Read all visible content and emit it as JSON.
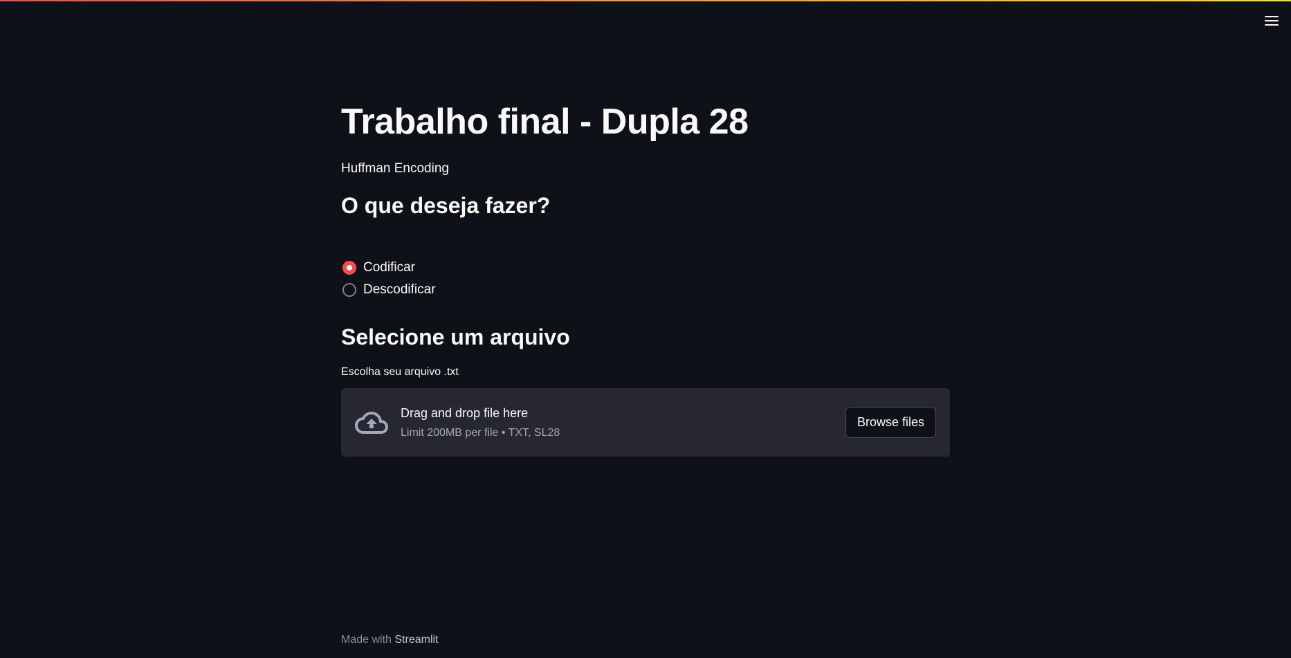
{
  "header": {
    "menu_icon": "hamburger-menu-icon"
  },
  "main": {
    "title": "Trabalho final - Dupla 28",
    "subtitle": "Huffman Encoding",
    "question": "O que deseja fazer?",
    "radio": {
      "options": [
        "Codificar",
        "Descodificar"
      ],
      "selected": "Codificar"
    },
    "file_section": {
      "heading": "Selecione um arquivo",
      "label": "Escolha seu arquivo .txt",
      "dropzone": {
        "icon": "cloud-upload-icon",
        "title": "Drag and drop file here",
        "subtitle": "Limit 200MB per file • TXT, SL28",
        "button_label": "Browse files"
      }
    }
  },
  "footer": {
    "prefix": "Made with",
    "link": "Streamlit"
  },
  "colors": {
    "background": "#0e1117",
    "accent": "#ff4b4b",
    "dropzone": "#262730"
  }
}
